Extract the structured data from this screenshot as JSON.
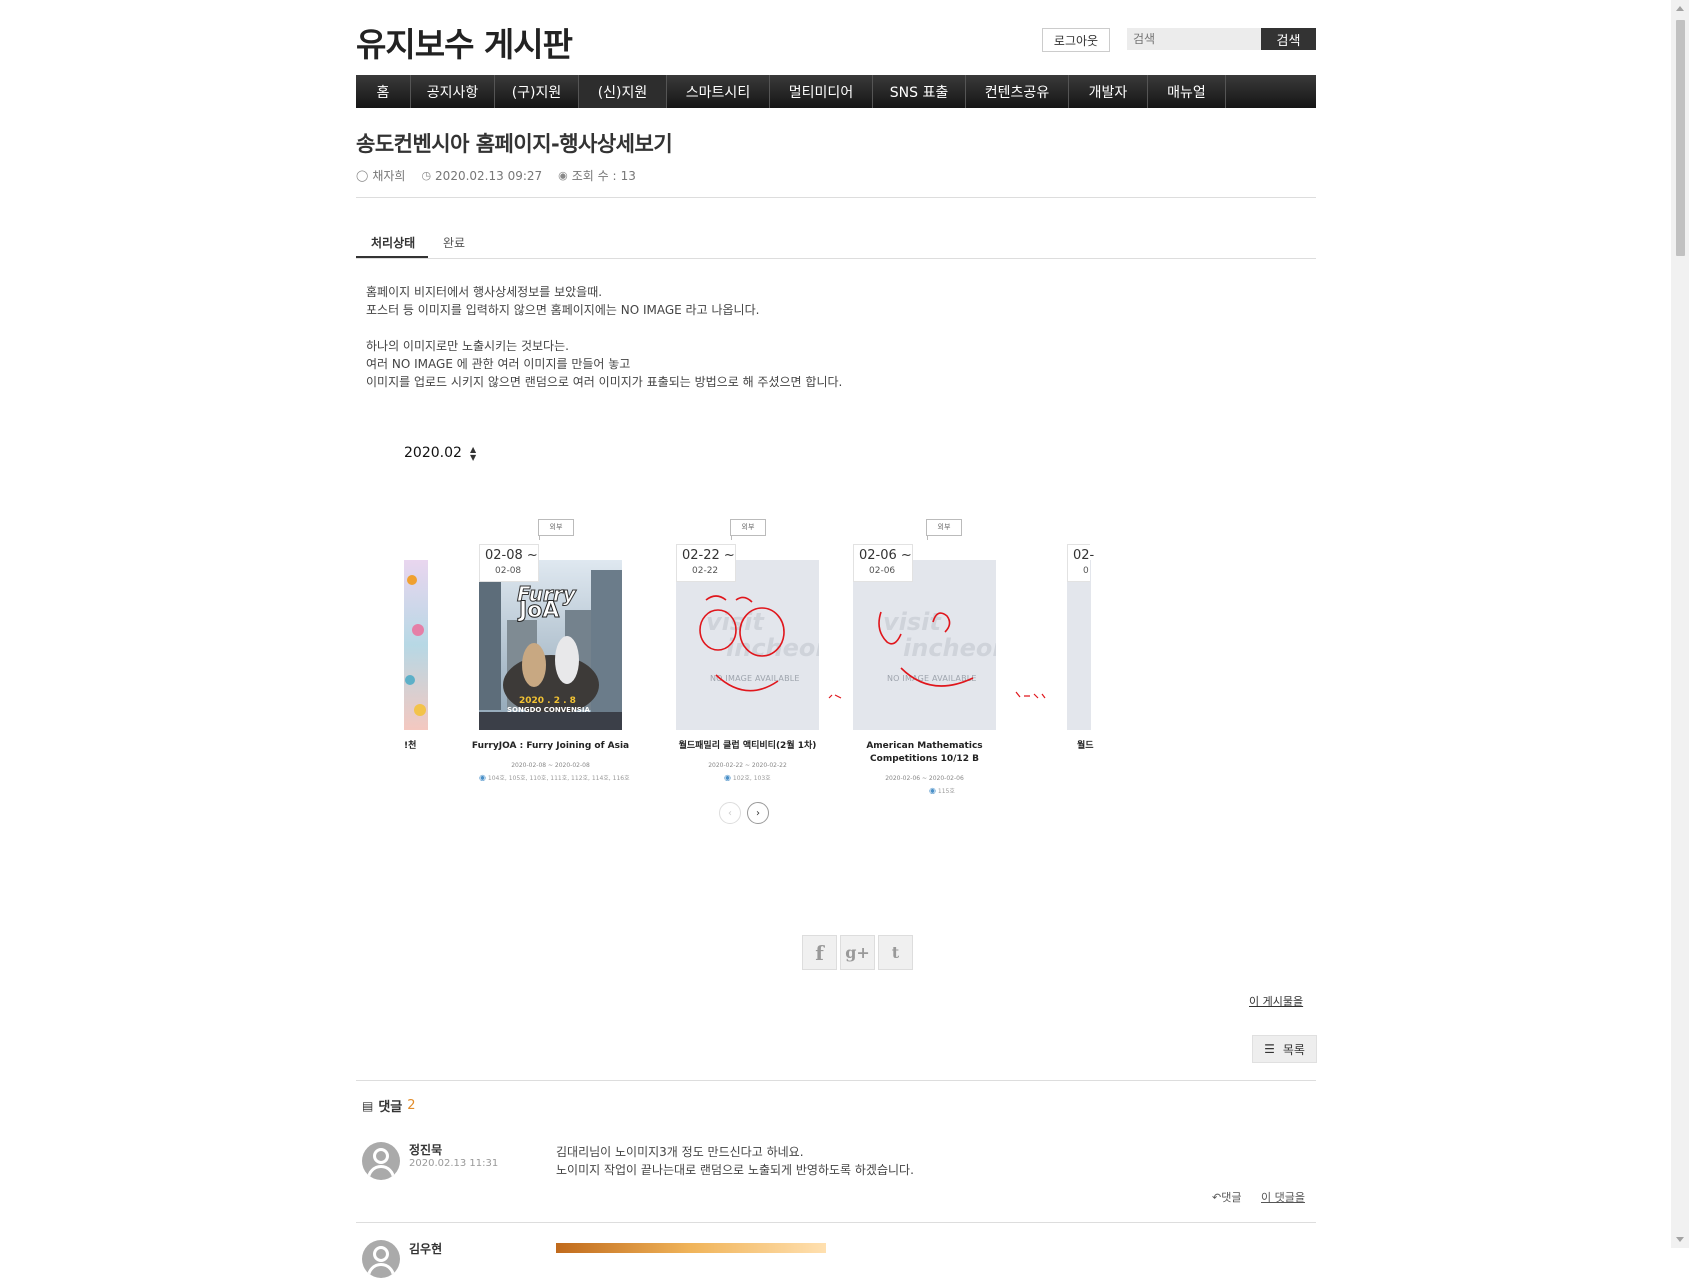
{
  "header": {
    "site_title": "유지보수 게시판",
    "logout_label": "로그아웃",
    "search_placeholder": "검색",
    "search_button": "검색"
  },
  "nav": {
    "items": [
      {
        "label": "홈"
      },
      {
        "label": "공지사항"
      },
      {
        "label": "(구)지원"
      },
      {
        "label": "(신)지원"
      },
      {
        "label": "스마트시티"
      },
      {
        "label": "멀티미디어"
      },
      {
        "label": "SNS 표출"
      },
      {
        "label": "컨텐츠공유"
      },
      {
        "label": "개발자"
      },
      {
        "label": "매뉴얼"
      }
    ]
  },
  "post": {
    "title": "송도컨벤시아 홈페이지-행사상세보기",
    "author": "채자희",
    "datetime": "2020.02.13 09:27",
    "views_label": "조회 수 :",
    "views": "13",
    "status_label": "처리상태",
    "status_value": "완료",
    "body_lines": [
      "홈페이지 비지터에서 행사상세정보를 보았을때.",
      "포스터 등 이미지를 입력하지 않으면 홈페이지에는 NO IMAGE 라고 나옵니다.",
      "",
      "하나의 이미지로만 노출시키는 것보다는.",
      "여러 NO IMAGE 에 관한 여러 이미지를 만들어 놓고",
      "이미지를 업로드 시키지 않으면 랜덤으로 여러 이미지가 표출되는 방법으로 해 주셨으면 합니다."
    ]
  },
  "embed": {
    "month": "2020.02",
    "cards": [
      {
        "start": "02-08 ~",
        "end": "02-08",
        "tag": "외부",
        "name": "FurryJOA : Furry Joining of Asia",
        "period": "2020-02-08 ~ 2020-02-08",
        "place": "104호, 105호, 110호, 111호, 112호, 114호, 116호"
      },
      {
        "start": "02-22 ~",
        "end": "02-22",
        "tag": "외부",
        "name": "월드패밀리 클럽 액티비티(2월 1차)",
        "period": "2020-02-22 ~ 2020-02-22",
        "place": "102호, 103호"
      },
      {
        "start": "02-06 ~",
        "end": "02-06",
        "tag": "외부",
        "name": "American Mathematics Competitions 10/12 B",
        "period": "2020-02-06 ~ 2020-02-06",
        "place": "115호"
      }
    ],
    "partial_left_name": "!천",
    "partial_right_start": "02-",
    "partial_right_end": "0",
    "partial_right_name": "월드",
    "no_image_visit": "visit",
    "no_image_incheon": "incheon",
    "no_image_text": "NO IMAGE AVAILABLE",
    "poster_title_1": "Furry",
    "poster_title_2": "JoA",
    "poster_date": "2020 . 2 . 8",
    "poster_venue": "SONGDO CONVENSIA"
  },
  "share": {
    "facebook": "f",
    "googleplus": "g+",
    "twitter": "t"
  },
  "actions": {
    "this_post": "이 게시물을",
    "list_label": "목록"
  },
  "comments": {
    "title": "댓글",
    "count": "2",
    "items": [
      {
        "author": "정진묵",
        "date": "2020.02.13 11:31",
        "lines": [
          "김대리님이 노이미지3개 정도 만드신다고 하네요.",
          "노이미지 작업이 끝나는대로 랜덤으로 노출되게 반영하도록 하겠습니다."
        ],
        "reply_label": "댓글",
        "reply2_label": "이 댓글을"
      },
      {
        "author": "김우현"
      }
    ]
  },
  "colors": {
    "nav_bg": "#1e1e1e",
    "accent_count": "#e28c2a",
    "annotation_red": "#e0161c"
  }
}
